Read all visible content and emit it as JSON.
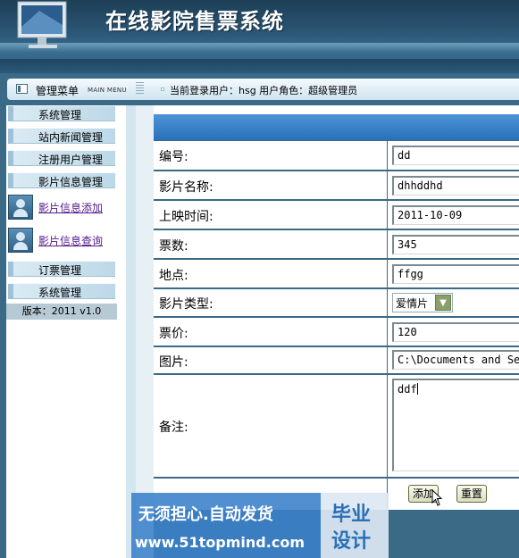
{
  "app": {
    "title": "在线影院售票系统"
  },
  "topbar": {
    "menu_label": "管理菜单",
    "menu_sub": "MAIN MENU",
    "user_info": "当前登录用户：hsg   用户角色：超级管理员"
  },
  "sidebar": {
    "items": [
      {
        "label": "系统管理",
        "kind": "section"
      },
      {
        "label": "站内新闻管理",
        "kind": "section"
      },
      {
        "label": "注册用户管理",
        "kind": "section"
      },
      {
        "label": "影片信息管理",
        "kind": "section"
      },
      {
        "label": "影片信息添加",
        "kind": "link"
      },
      {
        "label": "影片信息查询",
        "kind": "link"
      },
      {
        "label": "订票管理",
        "kind": "section"
      },
      {
        "label": "系统管理",
        "kind": "section"
      }
    ],
    "version": "版本：2011 v1.0"
  },
  "form": {
    "fields": [
      {
        "label": "编号:",
        "value": "dd"
      },
      {
        "label": "影片名称:",
        "value": "dhhddhd"
      },
      {
        "label": "上映时间:",
        "value": "2011-10-09"
      },
      {
        "label": "票数:",
        "value": "345"
      },
      {
        "label": "地点:",
        "value": "ffgg"
      },
      {
        "label": "影片类型:",
        "value": "爱情片"
      },
      {
        "label": "票价:",
        "value": "120"
      },
      {
        "label": "图片:",
        "value": "C:\\Documents and Set"
      },
      {
        "label": "备注:",
        "value": "ddf"
      }
    ],
    "buttons": {
      "submit": "添加",
      "reset": "重置"
    }
  },
  "watermark": {
    "line1": "无须担心.自动发货",
    "line2": "www.51topmind.com",
    "box1": "毕业",
    "box2": "设计"
  },
  "colors": {
    "frame": "#3a6a86",
    "form_header": "#2a70b8",
    "link": "#551a8b"
  },
  "icons": [
    "menu-icon",
    "monitor-logo-icon",
    "user-icon",
    "dropdown-arrow-icon",
    "mouse-cursor-icon"
  ]
}
